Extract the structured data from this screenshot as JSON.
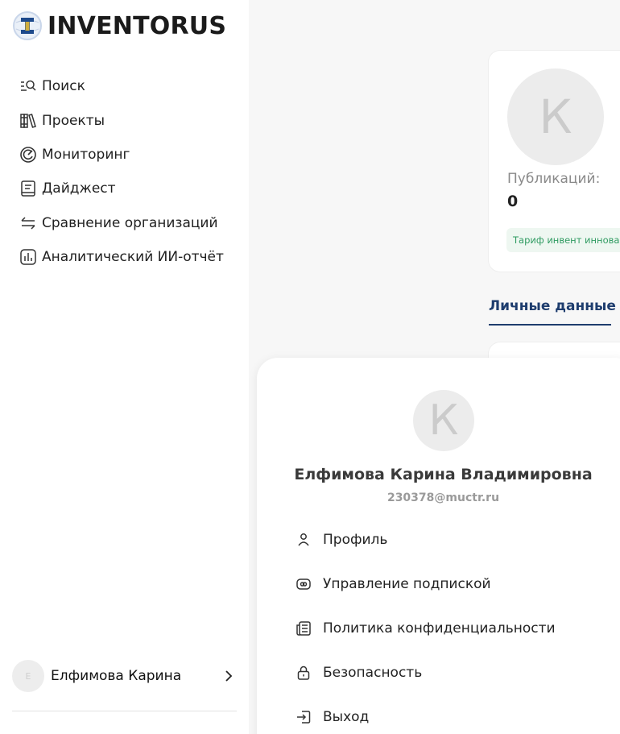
{
  "brand": {
    "name": "INVENTORUS"
  },
  "sidebar": {
    "items": [
      {
        "label": "Поиск",
        "icon": "search-list-icon"
      },
      {
        "label": "Проекты",
        "icon": "books-icon"
      },
      {
        "label": "Мониторинг",
        "icon": "monitoring-icon"
      },
      {
        "label": "Дайджест",
        "icon": "digest-icon"
      },
      {
        "label": "Сравнение организаций",
        "icon": "compare-arrows-icon"
      },
      {
        "label": "Аналитический ИИ-отчёт",
        "icon": "analytics-chart-icon"
      }
    ],
    "user": {
      "initial": "Е",
      "name": "Елфимова Карина"
    }
  },
  "profile_card": {
    "initial": "К",
    "publications_label": "Публикаций:",
    "publications_value": "0",
    "tariff": "Тариф инвент инновационный"
  },
  "tabs": {
    "personal": "Личные данные"
  },
  "user_menu": {
    "initial": "К",
    "full_name": "Елфимова Карина Владимировна",
    "email": "230378@muctr.ru",
    "items": [
      {
        "label": "Профиль",
        "icon": "person-icon"
      },
      {
        "label": "Управление подпиской",
        "icon": "subscription-icon"
      },
      {
        "label": "Политика конфиденциальности",
        "icon": "policy-icon"
      },
      {
        "label": "Безопасность",
        "icon": "lock-icon"
      },
      {
        "label": "Выход",
        "icon": "logout-icon"
      }
    ]
  },
  "colors": {
    "accent": "#1e3d6e",
    "tariff_text": "#2f9b61",
    "tariff_bg": "#eef7f1"
  }
}
